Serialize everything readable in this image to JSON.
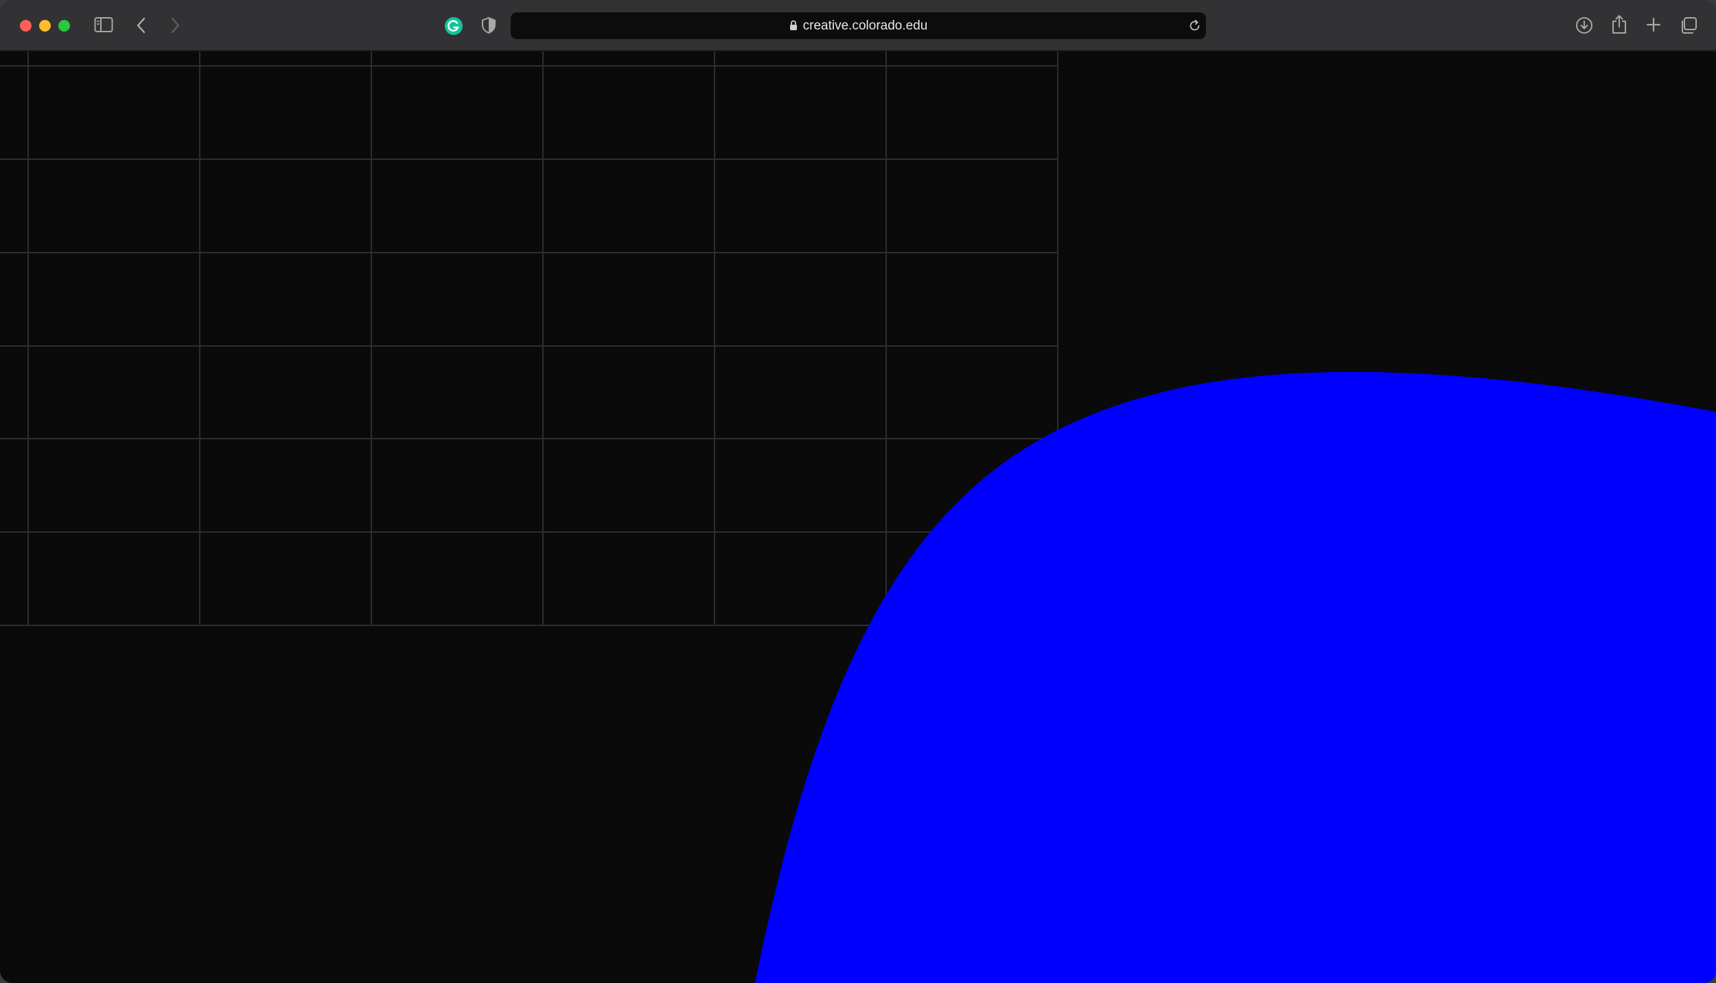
{
  "browser": {
    "url": "creative.colorado.edu",
    "icons": {
      "sidebar": "sidebar-toggle-icon",
      "back": "back-chevron-icon",
      "forward": "forward-chevron-icon",
      "extension": "grammarly-icon",
      "privacy": "privacy-shield-icon",
      "lock": "lock-icon",
      "reload": "reload-icon",
      "downloads": "downloads-icon",
      "share": "share-icon",
      "new_tab": "new-tab-plus-icon",
      "tabs_overview": "tab-overview-icon"
    }
  },
  "page": {
    "background_color": "#0a0a0a",
    "grid_line_color": "#2e2e2e",
    "blob_color": "#0000ff"
  }
}
